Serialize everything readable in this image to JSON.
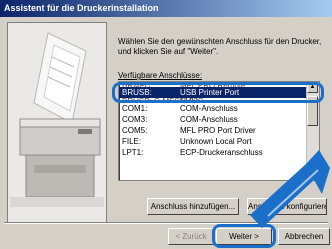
{
  "window": {
    "title": "Assistent für die Druckerinstallation"
  },
  "instruction": "Wählen Sie den gewünschten Anschluss für den Drucker, und klicken Sie auf \"Weiter\".",
  "ports_label": "Verfügbare Anschlüsse:",
  "ports": [
    {
      "port": "BRUSB:",
      "desc": "USB Printer Port",
      "selected": true
    },
    {
      "port": "BRUSB: C-MFC5100C...",
      "desc": "NULL",
      "partial": true
    },
    {
      "port": "COM1:",
      "desc": "COM-Anschluss"
    },
    {
      "port": "COM3:",
      "desc": "COM-Anschluss"
    },
    {
      "port": "COM5:",
      "desc": "MFL PRO Port Driver"
    },
    {
      "port": "FILE:",
      "desc": "Unknown Local Port"
    },
    {
      "port": "LPT1:",
      "desc": "ECP-Druckeranschluss"
    }
  ],
  "buttons": {
    "add_port": "Anschluss hinzufügen...",
    "configure_port": "Anschluss konfigurieren...",
    "back": "< Zurück",
    "next": "Weiter >",
    "cancel": "Abbrechen"
  },
  "colors": {
    "highlight": "#1b6fc8",
    "selection": "#0a246a"
  }
}
